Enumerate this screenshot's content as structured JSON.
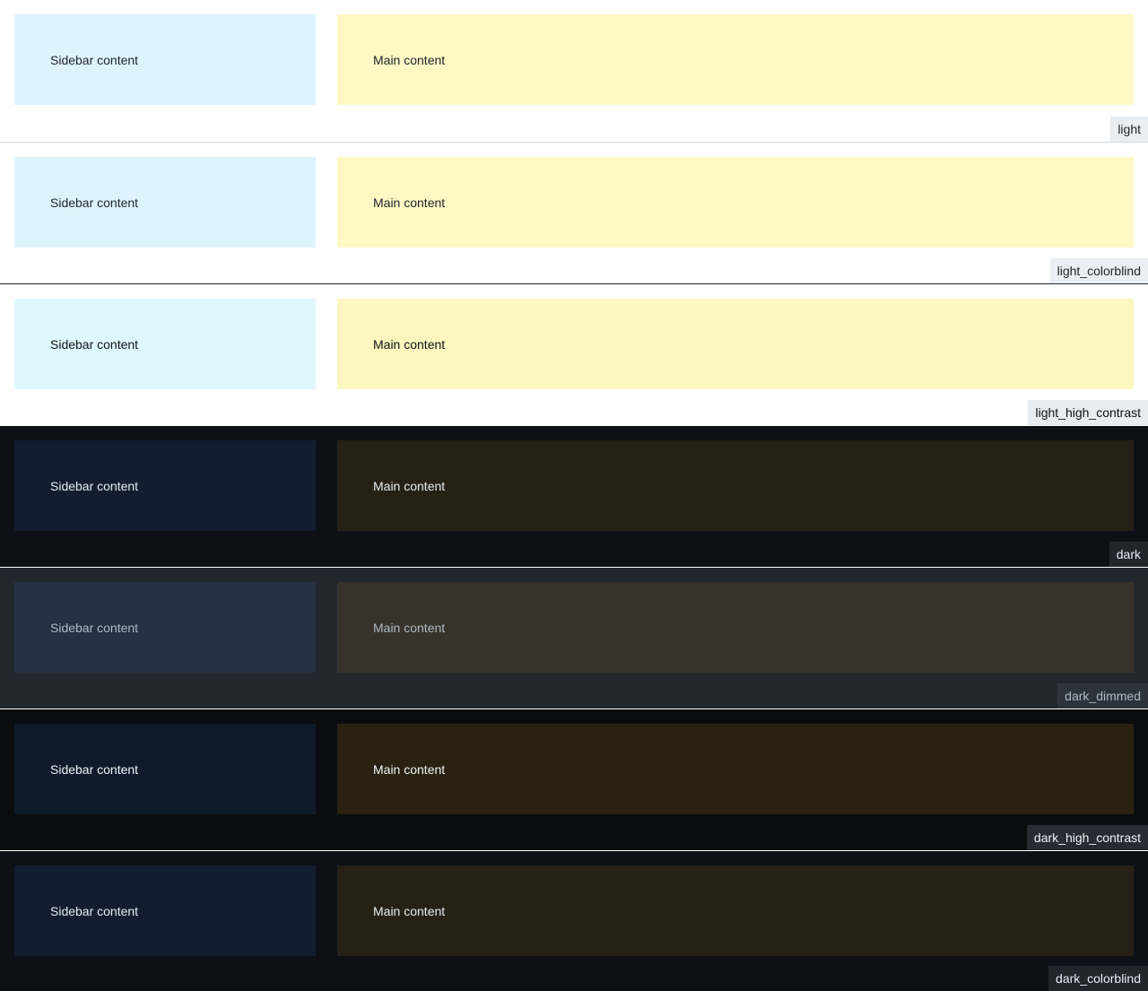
{
  "themes": [
    {
      "name": "light",
      "sidebar_text": "Sidebar content",
      "main_text": "Main content",
      "colors": {
        "bg": "#ffffff",
        "sidebar": "#ddf4ff",
        "main": "#fff8c5",
        "text": "#1f2328",
        "label_bg": "#eaeef2",
        "label_text": "#1f2328",
        "border": "#d0d7de"
      }
    },
    {
      "name": "light_colorblind",
      "sidebar_text": "Sidebar content",
      "main_text": "Main content",
      "colors": {
        "bg": "#ffffff",
        "sidebar": "#ddf4ff",
        "main": "#fff8c5",
        "text": "#1f2328",
        "label_bg": "#eaeef2",
        "label_text": "#1f2328",
        "border": "#d0d7de"
      }
    },
    {
      "name": "light_high_contrast",
      "sidebar_text": "Sidebar content",
      "main_text": "Main content",
      "colors": {
        "bg": "#ffffff",
        "sidebar": "#dff7ff",
        "main": "#fcf7be",
        "text": "#0e1116",
        "label_bg": "#e7ecf0",
        "label_text": "#0e1116",
        "border": "#20252c"
      }
    },
    {
      "name": "dark",
      "sidebar_text": "Sidebar content",
      "main_text": "Main content",
      "colors": {
        "bg": "#0d1117",
        "sidebar": "#121d2f",
        "main": "#272115",
        "text": "#e6edf3",
        "label_bg": "#21262d",
        "label_text": "#e6edf3",
        "border": "#ffffff"
      }
    },
    {
      "name": "dark_dimmed",
      "sidebar_text": "Sidebar content",
      "main_text": "Main content",
      "colors": {
        "bg": "#22272e",
        "sidebar": "#243142",
        "main": "#37332a",
        "text": "#adbac7",
        "label_bg": "#2d333b",
        "label_text": "#adbac7",
        "border": "#ffffff"
      }
    },
    {
      "name": "dark_high_contrast",
      "sidebar_text": "Sidebar content",
      "main_text": "Main content",
      "colors": {
        "bg": "#0a0c10",
        "sidebar": "#0f1b2a",
        "main": "#2a2111",
        "text": "#f0f3f6",
        "label_bg": "#272b33",
        "label_text": "#f0f3f6",
        "border": "#ffffff"
      }
    },
    {
      "name": "dark_colorblind",
      "sidebar_text": "Sidebar content",
      "main_text": "Main content",
      "colors": {
        "bg": "#0d1117",
        "sidebar": "#121d2f",
        "main": "#272115",
        "text": "#e6edf3",
        "label_bg": "#21262d",
        "label_text": "#e6edf3",
        "border": "#ffffff"
      }
    }
  ]
}
